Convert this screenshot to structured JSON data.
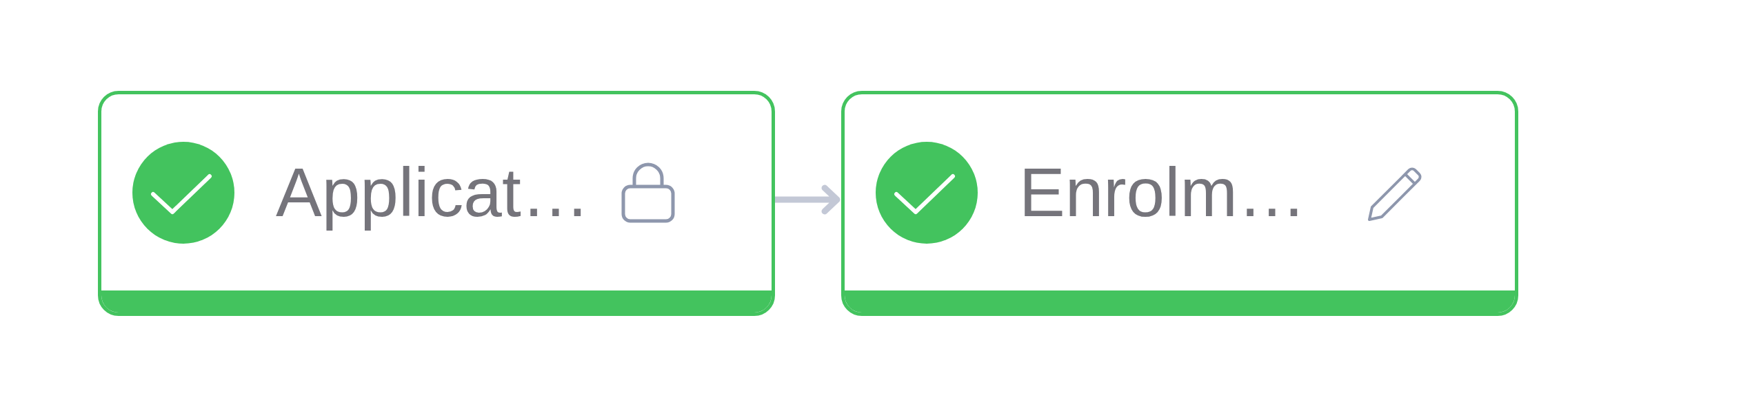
{
  "steps": [
    {
      "label": "Applicat…",
      "done": true,
      "kind": "lock"
    },
    {
      "label": "Enrolm…",
      "done": true,
      "kind": "edit"
    }
  ]
}
